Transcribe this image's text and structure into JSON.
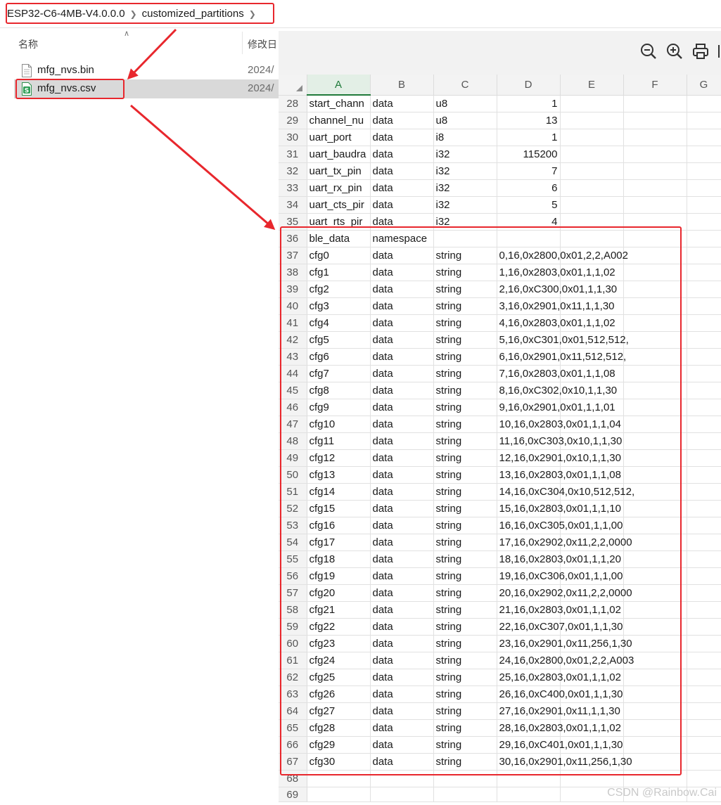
{
  "breadcrumb": {
    "items": [
      "ESP32-C6-4MB-V4.0.0.0",
      "customized_partitions"
    ]
  },
  "explorer": {
    "columns": {
      "name": "名称",
      "date": "修改日"
    },
    "files": [
      {
        "name": "mfg_nvs.bin",
        "date": "2024/",
        "icon": "generic-file-icon",
        "selected": false
      },
      {
        "name": "mfg_nvs.csv",
        "date": "2024/",
        "icon": "spreadsheet-file-icon",
        "selected": true
      }
    ]
  },
  "toolbar": {
    "icons": [
      "zoom-out-icon",
      "zoom-in-icon",
      "print-icon"
    ]
  },
  "sheet": {
    "columns": [
      "A",
      "B",
      "C",
      "D",
      "E",
      "F",
      "G"
    ],
    "active_column": "A",
    "rows": [
      {
        "n": "28",
        "a": "start_chann",
        "b": "data",
        "c": "u8",
        "d": "1"
      },
      {
        "n": "29",
        "a": "channel_nu",
        "b": "data",
        "c": "u8",
        "d": "13"
      },
      {
        "n": "30",
        "a": "uart_port",
        "b": "data",
        "c": "i8",
        "d": "1"
      },
      {
        "n": "31",
        "a": "uart_baudra",
        "b": "data",
        "c": "i32",
        "d": "115200"
      },
      {
        "n": "32",
        "a": "uart_tx_pin",
        "b": "data",
        "c": "i32",
        "d": "7"
      },
      {
        "n": "33",
        "a": "uart_rx_pin",
        "b": "data",
        "c": "i32",
        "d": "6"
      },
      {
        "n": "34",
        "a": "uart_cts_pir",
        "b": "data",
        "c": "i32",
        "d": "5"
      },
      {
        "n": "35",
        "a": "uart_rts_pir",
        "b": "data",
        "c": "i32",
        "d": "4"
      },
      {
        "n": "36",
        "a": "ble_data",
        "b": "namespace",
        "c": "",
        "d": ""
      },
      {
        "n": "37",
        "a": "cfg0",
        "b": "data",
        "c": "string",
        "d": "0,16,0x2800,0x01,2,2,A002"
      },
      {
        "n": "38",
        "a": "cfg1",
        "b": "data",
        "c": "string",
        "d": "1,16,0x2803,0x01,1,1,02"
      },
      {
        "n": "39",
        "a": "cfg2",
        "b": "data",
        "c": "string",
        "d": "2,16,0xC300,0x01,1,1,30"
      },
      {
        "n": "40",
        "a": "cfg3",
        "b": "data",
        "c": "string",
        "d": "3,16,0x2901,0x11,1,1,30"
      },
      {
        "n": "41",
        "a": "cfg4",
        "b": "data",
        "c": "string",
        "d": "4,16,0x2803,0x01,1,1,02"
      },
      {
        "n": "42",
        "a": "cfg5",
        "b": "data",
        "c": "string",
        "d": "5,16,0xC301,0x01,512,512,"
      },
      {
        "n": "43",
        "a": "cfg6",
        "b": "data",
        "c": "string",
        "d": "6,16,0x2901,0x11,512,512,"
      },
      {
        "n": "44",
        "a": "cfg7",
        "b": "data",
        "c": "string",
        "d": "7,16,0x2803,0x01,1,1,08"
      },
      {
        "n": "45",
        "a": "cfg8",
        "b": "data",
        "c": "string",
        "d": "8,16,0xC302,0x10,1,1,30"
      },
      {
        "n": "46",
        "a": "cfg9",
        "b": "data",
        "c": "string",
        "d": "9,16,0x2901,0x01,1,1,01"
      },
      {
        "n": "47",
        "a": "cfg10",
        "b": "data",
        "c": "string",
        "d": "10,16,0x2803,0x01,1,1,04"
      },
      {
        "n": "48",
        "a": "cfg11",
        "b": "data",
        "c": "string",
        "d": "11,16,0xC303,0x10,1,1,30"
      },
      {
        "n": "49",
        "a": "cfg12",
        "b": "data",
        "c": "string",
        "d": "12,16,0x2901,0x10,1,1,30"
      },
      {
        "n": "50",
        "a": "cfg13",
        "b": "data",
        "c": "string",
        "d": "13,16,0x2803,0x01,1,1,08"
      },
      {
        "n": "51",
        "a": "cfg14",
        "b": "data",
        "c": "string",
        "d": "14,16,0xC304,0x10,512,512,"
      },
      {
        "n": "52",
        "a": "cfg15",
        "b": "data",
        "c": "string",
        "d": "15,16,0x2803,0x01,1,1,10"
      },
      {
        "n": "53",
        "a": "cfg16",
        "b": "data",
        "c": "string",
        "d": "16,16,0xC305,0x01,1,1,00"
      },
      {
        "n": "54",
        "a": "cfg17",
        "b": "data",
        "c": "string",
        "d": "17,16,0x2902,0x11,2,2,0000"
      },
      {
        "n": "55",
        "a": "cfg18",
        "b": "data",
        "c": "string",
        "d": "18,16,0x2803,0x01,1,1,20"
      },
      {
        "n": "56",
        "a": "cfg19",
        "b": "data",
        "c": "string",
        "d": "19,16,0xC306,0x01,1,1,00"
      },
      {
        "n": "57",
        "a": "cfg20",
        "b": "data",
        "c": "string",
        "d": "20,16,0x2902,0x11,2,2,0000"
      },
      {
        "n": "58",
        "a": "cfg21",
        "b": "data",
        "c": "string",
        "d": "21,16,0x2803,0x01,1,1,02"
      },
      {
        "n": "59",
        "a": "cfg22",
        "b": "data",
        "c": "string",
        "d": "22,16,0xC307,0x01,1,1,30"
      },
      {
        "n": "60",
        "a": "cfg23",
        "b": "data",
        "c": "string",
        "d": "23,16,0x2901,0x11,256,1,30"
      },
      {
        "n": "61",
        "a": "cfg24",
        "b": "data",
        "c": "string",
        "d": "24,16,0x2800,0x01,2,2,A003"
      },
      {
        "n": "62",
        "a": "cfg25",
        "b": "data",
        "c": "string",
        "d": "25,16,0x2803,0x01,1,1,02"
      },
      {
        "n": "63",
        "a": "cfg26",
        "b": "data",
        "c": "string",
        "d": "26,16,0xC400,0x01,1,1,30"
      },
      {
        "n": "64",
        "a": "cfg27",
        "b": "data",
        "c": "string",
        "d": "27,16,0x2901,0x11,1,1,30"
      },
      {
        "n": "65",
        "a": "cfg28",
        "b": "data",
        "c": "string",
        "d": "28,16,0x2803,0x01,1,1,02"
      },
      {
        "n": "66",
        "a": "cfg29",
        "b": "data",
        "c": "string",
        "d": "29,16,0xC401,0x01,1,1,30"
      },
      {
        "n": "67",
        "a": "cfg30",
        "b": "data",
        "c": "string",
        "d": "30,16,0x2901,0x11,256,1,30"
      },
      {
        "n": "68",
        "a": "",
        "b": "",
        "c": "",
        "d": ""
      },
      {
        "n": "69",
        "a": "",
        "b": "",
        "c": "",
        "d": ""
      }
    ]
  },
  "annotation": {
    "color": "#e8272d"
  },
  "watermark": "CSDN @Rainbow.Cai"
}
